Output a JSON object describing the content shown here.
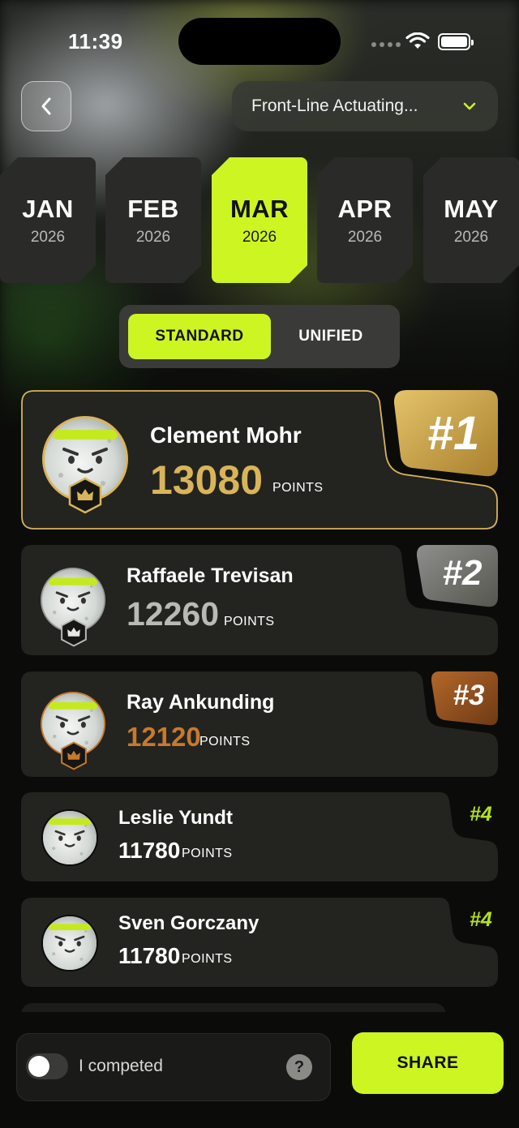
{
  "status": {
    "time": "11:39"
  },
  "header": {
    "selected_product": "Front-Line Actuating..."
  },
  "months": [
    {
      "name": "JAN",
      "year": "2026",
      "active": false
    },
    {
      "name": "FEB",
      "year": "2026",
      "active": false
    },
    {
      "name": "MAR",
      "year": "2026",
      "active": true
    },
    {
      "name": "APR",
      "year": "2026",
      "active": false
    },
    {
      "name": "MAY",
      "year": "2026",
      "active": false
    }
  ],
  "segments": {
    "standard": "STANDARD",
    "unified": "UNIFIED",
    "selected": "standard"
  },
  "leaderboard": [
    {
      "name": "Clement Mohr",
      "points": "13080",
      "unit": "POINTS",
      "rank": "#1"
    },
    {
      "name": "Raffaele Trevisan",
      "points": "12260",
      "unit": "POINTS",
      "rank": "#2"
    },
    {
      "name": "Ray Ankunding",
      "points": "12120",
      "unit": "POINTS",
      "rank": "#3"
    },
    {
      "name": "Leslie Yundt",
      "points": "11780",
      "unit": "POINTS",
      "rank": "#4"
    },
    {
      "name": "Sven Gorczany",
      "points": "11780",
      "unit": "POINTS",
      "rank": "#4"
    }
  ],
  "colors": {
    "accent": "#cdf521",
    "gold": "#d9b45a",
    "silver": "#b9bab6",
    "bronze": "#c8792f"
  },
  "footer": {
    "competed_label": "I competed",
    "help": "?",
    "share_label": "SHARE",
    "competed_on": false
  }
}
